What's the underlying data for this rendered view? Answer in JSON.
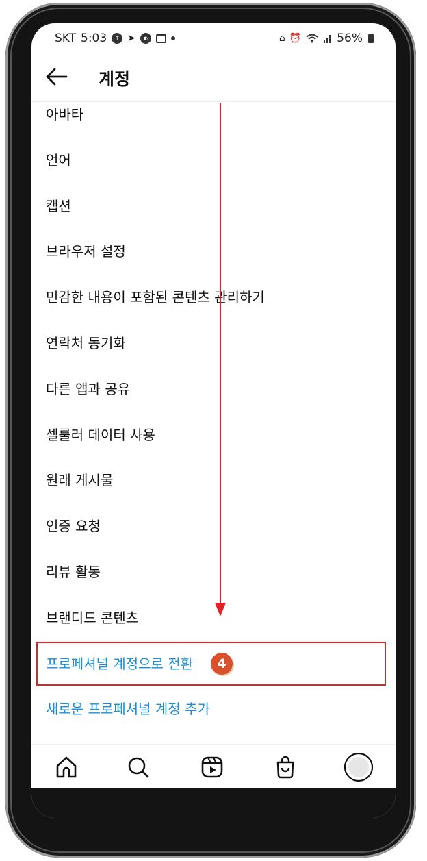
{
  "status_bar": {
    "carrier": "SKT",
    "time": "5:03",
    "battery": "56%"
  },
  "header": {
    "title": "계정"
  },
  "menu": {
    "items": [
      {
        "label": "아바타"
      },
      {
        "label": "언어"
      },
      {
        "label": "캡션"
      },
      {
        "label": "브라우저 설정"
      },
      {
        "label": "민감한 내용이 포함된 콘텐츠 관리하기"
      },
      {
        "label": "연락처 동기화"
      },
      {
        "label": "다른 앱과 공유"
      },
      {
        "label": "셀룰러 데이터 사용"
      },
      {
        "label": "원래 게시물"
      },
      {
        "label": "인증 요청"
      },
      {
        "label": "리뷰 활동"
      },
      {
        "label": "브랜디드 콘텐츠"
      },
      {
        "label": "프로페셔널 계정으로 전환"
      },
      {
        "label": "새로운 프로페셔널 계정 추가"
      }
    ]
  },
  "annotation": {
    "step": "4",
    "highlight_color": "#e0232b",
    "arrow_color": "#e0232b"
  },
  "colors": {
    "link_blue": "#1a8fd8",
    "badge": "#d9502c"
  },
  "bottom_nav": {
    "icons": [
      "home-icon",
      "search-icon",
      "reels-icon",
      "shop-icon",
      "profile-avatar-icon"
    ]
  }
}
